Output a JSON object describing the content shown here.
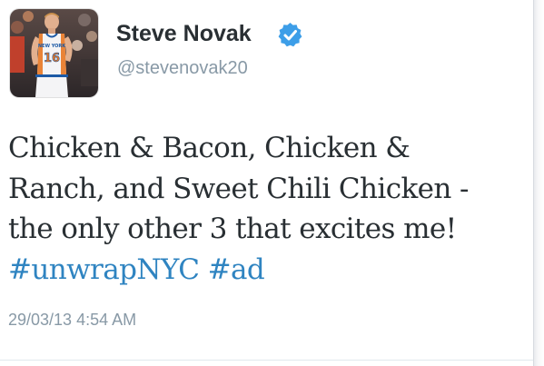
{
  "author": {
    "display_name": "Steve Novak",
    "handle": "@stevenovak20",
    "verified": true,
    "avatar_alt": "Basketball player in orange and blue jersey number 16",
    "jersey_text": "NEW YORK",
    "jersey_number": "16"
  },
  "tweet": {
    "lines": [
      "Chicken & Bacon, Chicken &",
      "Ranch, and Sweet Chili Chicken -",
      "the only other 3 that excites me!"
    ],
    "hashtags": [
      "#unwrapNYC",
      "#ad"
    ],
    "timestamp": "29/03/13 4:54 AM"
  },
  "icons": {
    "verified": "verified-badge-icon"
  },
  "colors": {
    "hashtag": "#2f84c1",
    "verified_badge": "#3d9ee8",
    "name": "#292f33",
    "muted": "#8899a6"
  }
}
